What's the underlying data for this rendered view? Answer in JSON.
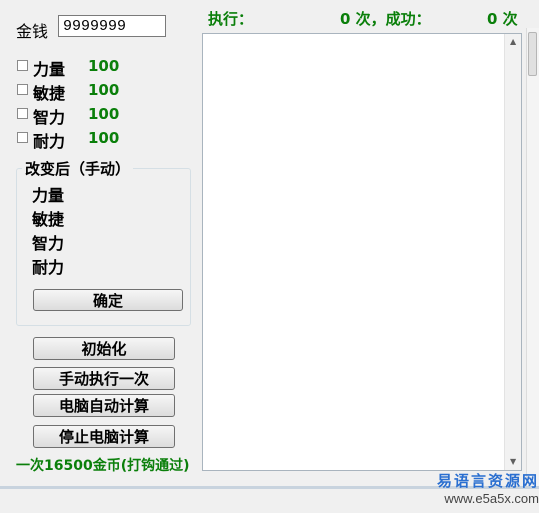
{
  "money": {
    "label": "金钱",
    "value": "9999999"
  },
  "attributes": [
    {
      "label": "力量",
      "value": "100"
    },
    {
      "label": "敏捷",
      "value": "100"
    },
    {
      "label": "智力",
      "value": "100"
    },
    {
      "label": "耐力",
      "value": "100"
    }
  ],
  "changed_group": {
    "title": "改变后（手动）",
    "items": [
      "力量",
      "敏捷",
      "智力",
      "耐力"
    ],
    "confirm_label": "确定"
  },
  "buttons": {
    "init": "初始化",
    "manual_once": "手动执行一次",
    "auto_calc": "电脑自动计算",
    "stop_calc": "停止电脑计算"
  },
  "cost_note": "一次16500金币(打钩通过)",
  "stats": {
    "exec_label": "执行：",
    "exec_count": "0 次，成功：",
    "success_count": "0 次"
  },
  "watermark": {
    "line1": "易语言资源网",
    "line2": "www.e5a5x.com"
  }
}
